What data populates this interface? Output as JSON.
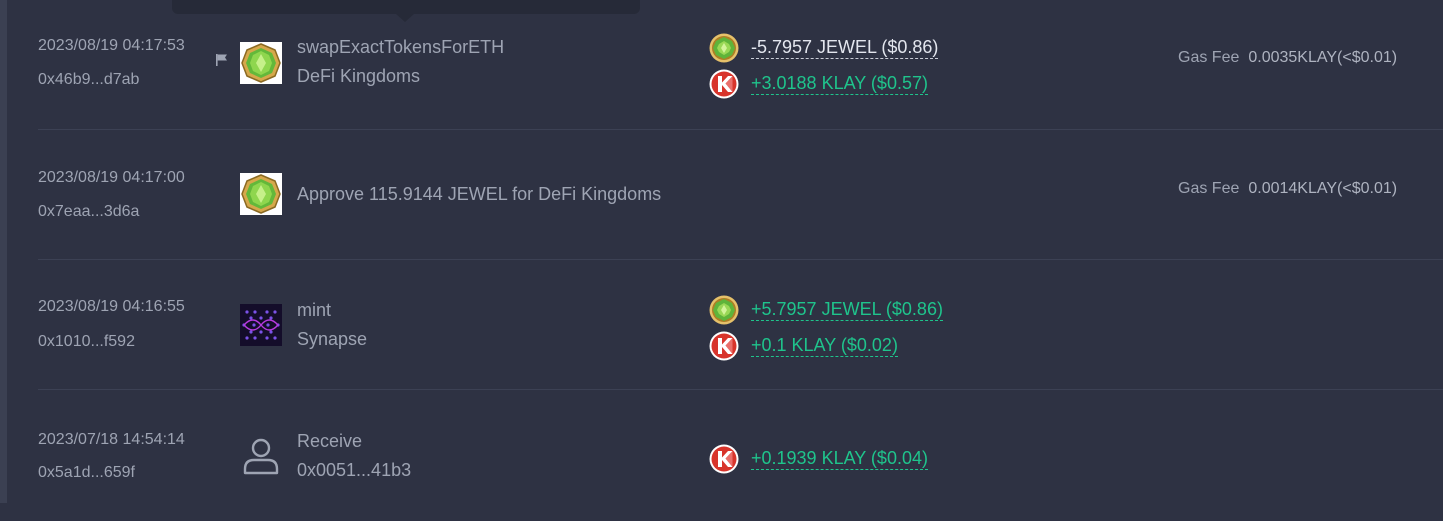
{
  "transactions": [
    {
      "time": "2023/08/19 04:17:53",
      "hash": "0x46b9...d7ab",
      "method": "swapExactTokensForETH",
      "sub": "DeFi Kingdoms",
      "app_icon": "defi-kingdoms-jewel-icon",
      "flagged": true,
      "transfers": [
        {
          "token_icon": "jewel-token-icon",
          "amount": "-5.7957 JEWEL ($0.86)",
          "direction": "out"
        },
        {
          "token_icon": "klay-token-icon",
          "amount": "+3.0188 KLAY ($0.57)",
          "direction": "in"
        }
      ],
      "gas_label": "Gas Fee",
      "gas_value": "0.0035KLAY(<$0.01)"
    },
    {
      "time": "2023/08/19 04:17:00",
      "hash": "0x7eaa...3d6a",
      "method": "Approve 115.9144 JEWEL for DeFi Kingdoms",
      "sub": "",
      "app_icon": "defi-kingdoms-jewel-icon",
      "flagged": false,
      "transfers": [],
      "gas_label": "Gas Fee",
      "gas_value": "0.0014KLAY(<$0.01)"
    },
    {
      "time": "2023/08/19 04:16:55",
      "hash": "0x1010...f592",
      "method": "mint",
      "sub": "Synapse",
      "app_icon": "synapse-icon",
      "flagged": false,
      "transfers": [
        {
          "token_icon": "jewel-token-icon",
          "amount": "+5.7957 JEWEL ($0.86)",
          "direction": "in"
        },
        {
          "token_icon": "klay-token-icon",
          "amount": "+0.1 KLAY ($0.02)",
          "direction": "in"
        }
      ],
      "gas_label": "",
      "gas_value": ""
    },
    {
      "time": "2023/07/18 14:54:14",
      "hash": "0x5a1d...659f",
      "method": "Receive",
      "sub": "0x0051...41b3",
      "app_icon": "user-icon",
      "flagged": false,
      "transfers": [
        {
          "token_icon": "klay-token-icon",
          "amount": "+0.1939 KLAY ($0.04)",
          "direction": "in"
        }
      ],
      "gas_label": "",
      "gas_value": ""
    }
  ],
  "colors": {
    "background": "#2e3243",
    "positive": "#1fc48c",
    "negative": "#e3e6ee",
    "muted_text": "#9ea4b3"
  }
}
